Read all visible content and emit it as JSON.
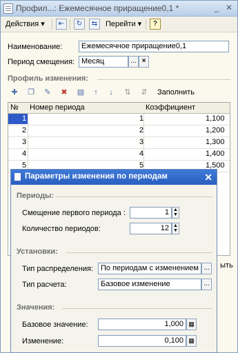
{
  "window": {
    "title": "Профил...: Ежемесячное приращение0,1 *"
  },
  "toolbar": {
    "actions": "Действия",
    "goto": "Перейти",
    "help": "?"
  },
  "form": {
    "name_label": "Наименование:",
    "name_value": "Ежемесячное приращение0,1",
    "period_label": "Период смещения:",
    "period_value": "Месяц",
    "period_btn": "...",
    "clear_btn": "×"
  },
  "profile": {
    "title": "Профиль изменения:",
    "fill_button": "Заполнить",
    "columns": [
      "№",
      "Номер периода",
      "Коэффициент"
    ],
    "rows": [
      {
        "n": "1",
        "period": "1",
        "coef": "1,100"
      },
      {
        "n": "2",
        "period": "2",
        "coef": "1,200"
      },
      {
        "n": "3",
        "period": "3",
        "coef": "1,300"
      },
      {
        "n": "4",
        "period": "4",
        "coef": "1,400"
      },
      {
        "n": "5",
        "period": "5",
        "coef": "1,500"
      }
    ]
  },
  "hidden_tail": "ыть",
  "dialog": {
    "title": "Параметры изменения по периодам",
    "periods_title": "Периоды:",
    "shift_label": "Смещение первого периода :",
    "shift_value": "1",
    "count_label": "Количество периодов:",
    "count_value": "12",
    "settings_title": "Установки:",
    "distribution_label": "Тип распределения:",
    "distribution_value": "По периодам с изменением",
    "calc_label": "Тип расчета:",
    "calc_value": "Базовое изменение",
    "values_title": "Значения:",
    "base_label": "Базовое значение:",
    "base_value": "1,000",
    "change_label": "Изменение:",
    "change_value": "0,100"
  }
}
